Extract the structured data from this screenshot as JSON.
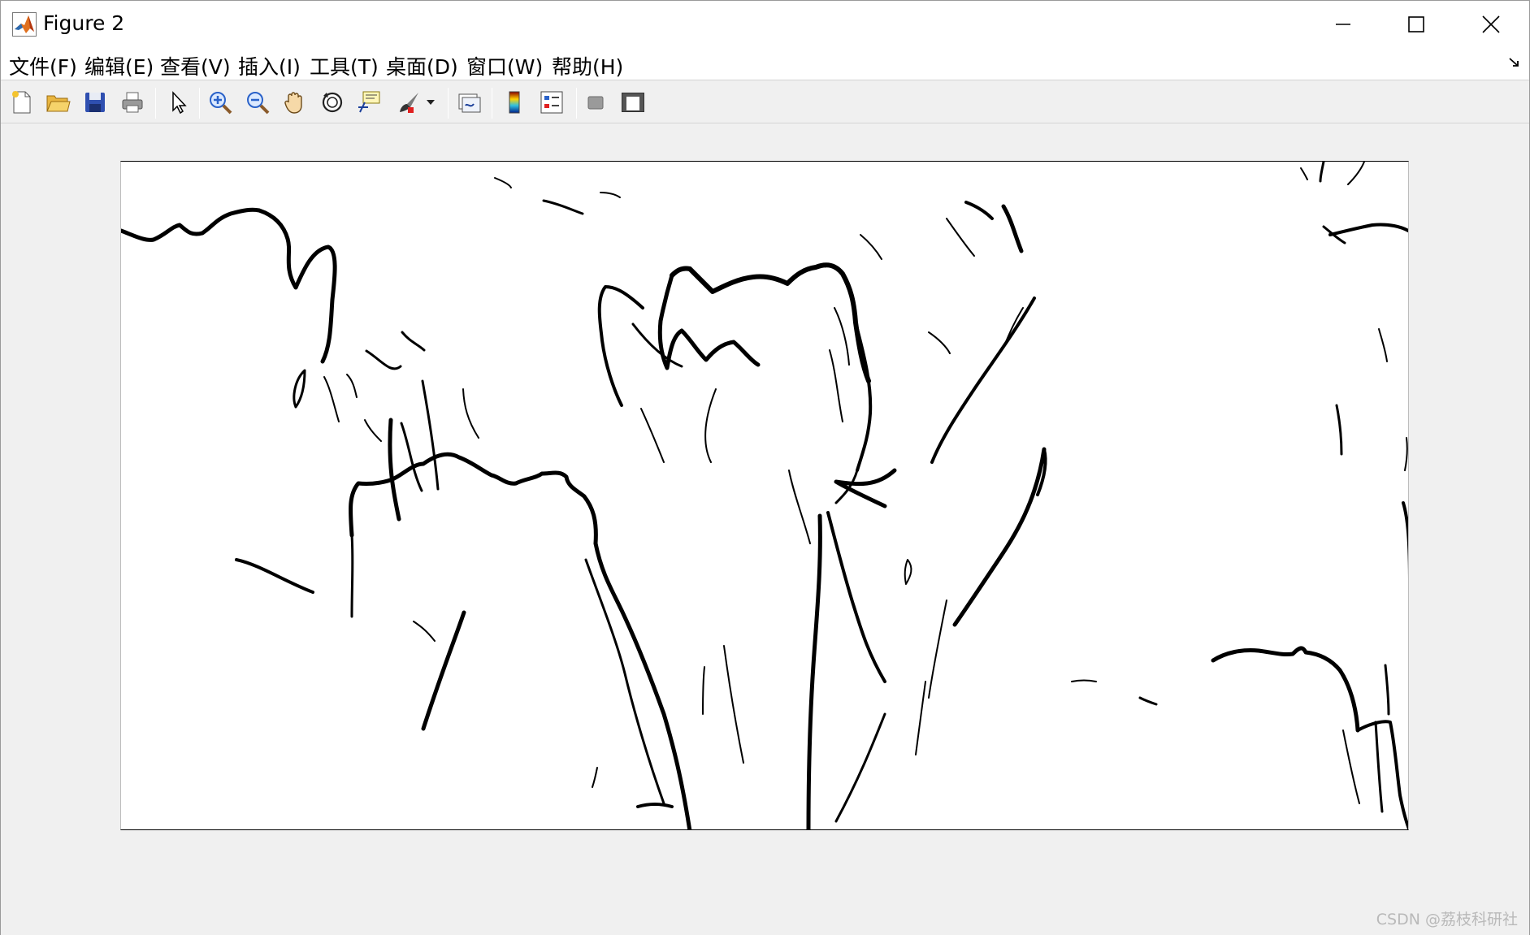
{
  "window": {
    "title": "Figure 2",
    "controls": {
      "minimize": "minimize",
      "maximize": "maximize",
      "close": "close"
    }
  },
  "menubar": {
    "items": [
      {
        "label": "文件(F)"
      },
      {
        "label": "编辑(E)"
      },
      {
        "label": "查看(V)"
      },
      {
        "label": "插入(I)"
      },
      {
        "label": "工具(T)"
      },
      {
        "label": "桌面(D)"
      },
      {
        "label": "窗口(W)"
      },
      {
        "label": "帮助(H)"
      }
    ]
  },
  "toolbar": {
    "tools": [
      {
        "name": "new-figure",
        "icon": "new-file-icon"
      },
      {
        "name": "open-file",
        "icon": "folder-open-icon"
      },
      {
        "name": "save-figure",
        "icon": "save-disk-icon"
      },
      {
        "name": "print-figure",
        "icon": "printer-icon"
      },
      {
        "name": "edit-plot",
        "icon": "arrow-pointer-icon"
      },
      {
        "name": "zoom-in",
        "icon": "zoom-in-icon"
      },
      {
        "name": "zoom-out",
        "icon": "zoom-out-icon"
      },
      {
        "name": "pan",
        "icon": "hand-pan-icon"
      },
      {
        "name": "rotate-3d",
        "icon": "rotate-3d-icon"
      },
      {
        "name": "data-cursor",
        "icon": "data-cursor-icon"
      },
      {
        "name": "brush",
        "icon": "brush-icon"
      },
      {
        "name": "link-plot",
        "icon": "link-plot-icon"
      },
      {
        "name": "colorbar",
        "icon": "colorbar-icon"
      },
      {
        "name": "legend",
        "icon": "legend-icon"
      },
      {
        "name": "hide-plot-tools",
        "icon": "hide-tools-icon"
      },
      {
        "name": "show-plot-tools",
        "icon": "show-tools-icon"
      }
    ]
  },
  "figure": {
    "image_description_kind": "binary edge map (black edges on white)",
    "edge_color": "#000000",
    "background_color": "#ffffff"
  },
  "watermark": "CSDN @荔枝科研社"
}
